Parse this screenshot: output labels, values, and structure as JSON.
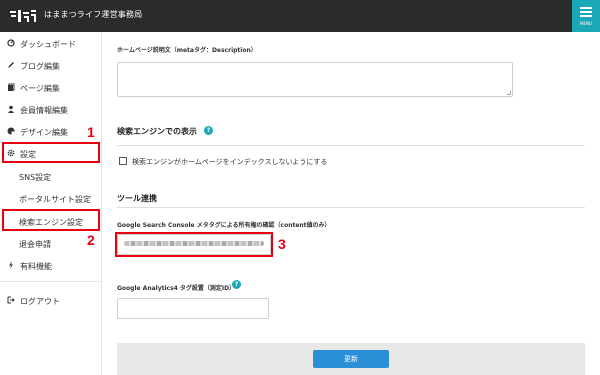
{
  "header": {
    "logo_text": "はまつライフ",
    "site_title": "はままつライフ運営事務局",
    "menu_label": "MENU"
  },
  "sidebar": {
    "items": [
      {
        "label": "ダッシュボード",
        "icon": "dashboard-icon"
      },
      {
        "label": "ブログ編集",
        "icon": "pencil-icon"
      },
      {
        "label": "ページ編集",
        "icon": "pages-icon"
      },
      {
        "label": "会員情報編集",
        "icon": "user-icon"
      },
      {
        "label": "デザイン編集",
        "icon": "palette-icon"
      },
      {
        "label": "設定",
        "icon": "gear-icon"
      },
      {
        "label": "SNS設定"
      },
      {
        "label": "ポータルサイト設定"
      },
      {
        "label": "検索エンジン設定"
      },
      {
        "label": "退会申請"
      },
      {
        "label": "有料機能",
        "icon": "bolt-icon"
      },
      {
        "label": "ログアウト",
        "icon": "logout-icon"
      }
    ]
  },
  "annotations": {
    "step1": "1",
    "step2": "2",
    "step3": "3",
    "color": "#e60012"
  },
  "main": {
    "meta_description_label": "ホームページ説明文（metaタグ：Description）",
    "meta_description_value": "",
    "search_engine_section": "検索エンジンでの表示",
    "noindex_label": "検索エンジンがホームページをインデックスしないようにする",
    "noindex_checked": false,
    "tools_section": "ツール連携",
    "gsc_label": "Google Search Console メタタグによる所有権の確認（content値のみ）",
    "ga4_label": "Google Analytics4 タグ設置（測定ID）",
    "ga4_value": "",
    "update_button": "更新"
  },
  "colors": {
    "header_bg": "#2b2b2b",
    "accent": "#1aa7b6",
    "button": "#2b8fd6"
  }
}
